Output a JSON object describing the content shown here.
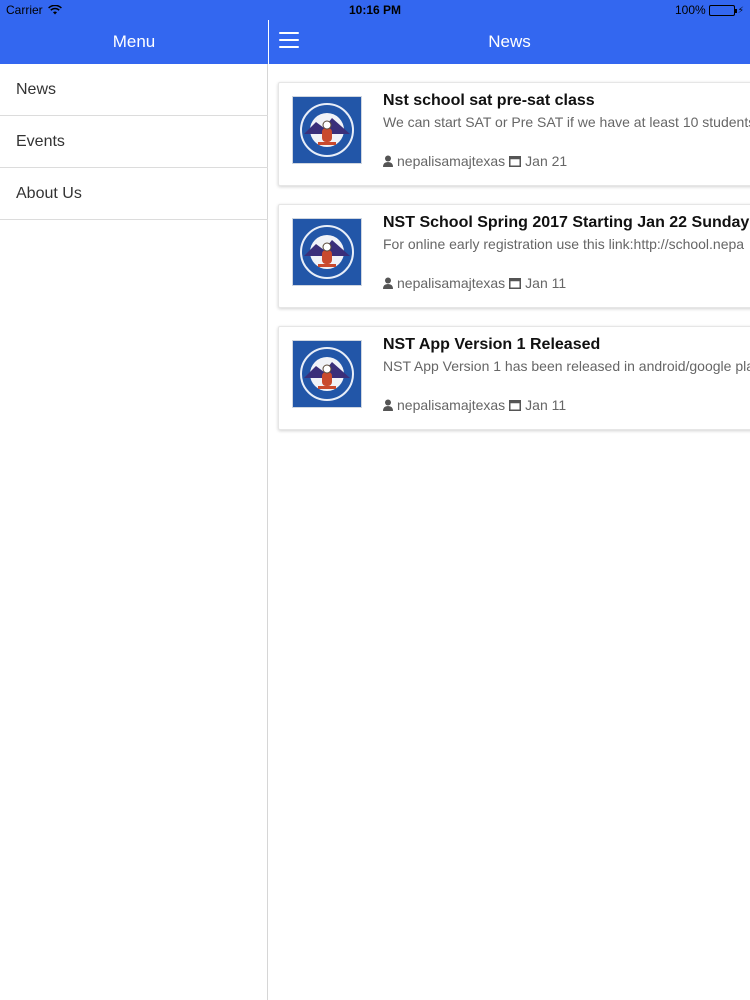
{
  "status": {
    "carrier": "Carrier",
    "time": "10:16 PM",
    "battery": "100%"
  },
  "sidebar": {
    "title": "Menu",
    "items": [
      {
        "label": "News"
      },
      {
        "label": "Events"
      },
      {
        "label": "About Us"
      }
    ]
  },
  "main": {
    "title": "News",
    "news": [
      {
        "title": "Nst school sat pre-sat class",
        "excerpt": "We can start SAT or Pre SAT if we have at least 10 students",
        "author": "nepalisamajtexas",
        "date": "Jan 21"
      },
      {
        "title": "NST School Spring 2017 Starting Jan 22 Sunday",
        "excerpt": "For online early registration use this link:http://school.nepa",
        "author": "nepalisamajtexas",
        "date": "Jan 11"
      },
      {
        "title": "NST App Version 1 Released",
        "excerpt": "NST App Version 1 has been released in android/google pla",
        "author": "nepalisamajtexas",
        "date": "Jan 11"
      }
    ]
  },
  "colors": {
    "accent": "#3367f0",
    "logo_bg": "#2256a8"
  },
  "icons": {
    "menu": "hamburger-icon",
    "author": "user-icon",
    "date": "calendar-icon",
    "wifi": "wifi-icon",
    "battery": "battery-icon"
  }
}
